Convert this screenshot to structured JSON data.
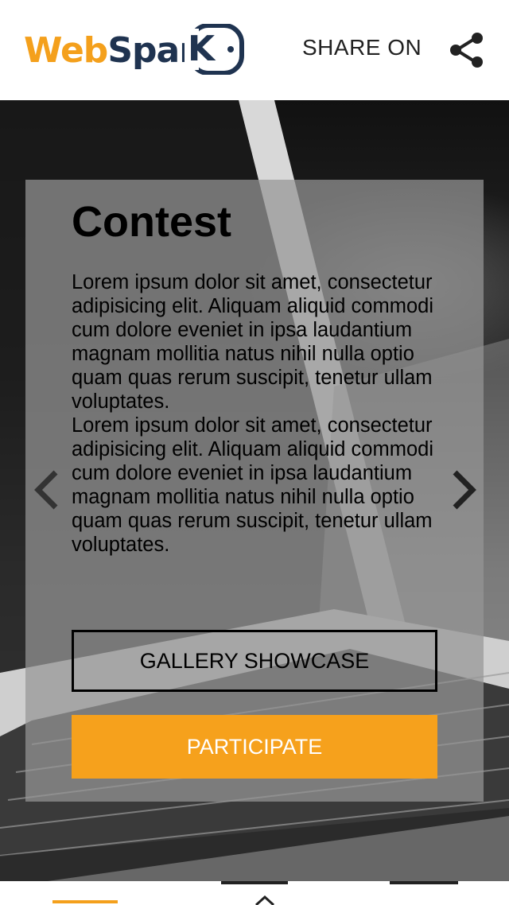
{
  "header": {
    "logo_part1": "Web",
    "logo_part2": "Spar",
    "logo_part3": "K",
    "share_label": "SHARE ON"
  },
  "content": {
    "title": "Contest",
    "paragraph1": "Lorem ipsum dolor sit amet, consectetur adipisicing elit. Aliquam aliquid commodi cum dolore eveniet in ipsa laudantium magnam mollitia natus nihil nulla optio quam quas rerum suscipit, tenetur ullam voluptates.",
    "paragraph2": "Lorem ipsum dolor sit amet, consectetur adipisicing elit. Aliquam aliquid commodi cum dolore eveniet in ipsa laudantium magnam mollitia natus nihil nulla optio quam quas rerum suscipit, tenetur ullam voluptates.",
    "gallery_button": "GALLERY SHOWCASE",
    "participate_button": "PARTICIPATE"
  },
  "icons": {
    "share": "share-icon",
    "prev": "chevron-left-icon",
    "next": "chevron-right-icon"
  },
  "colors": {
    "accent": "#f6a11c",
    "brand_dark": "#1f3350"
  }
}
